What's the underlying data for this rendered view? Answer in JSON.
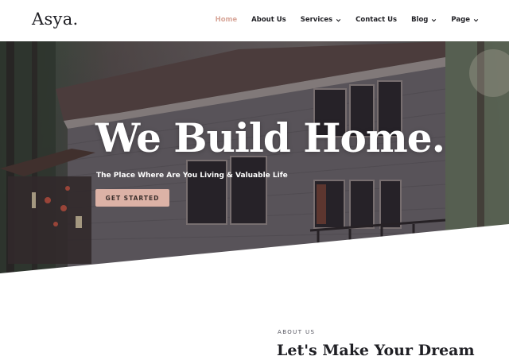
{
  "brand": {
    "logo_text": "Asya."
  },
  "nav": {
    "items": [
      {
        "label": "Home",
        "active": true,
        "has_dropdown": false
      },
      {
        "label": "About Us",
        "active": false,
        "has_dropdown": false
      },
      {
        "label": "Services",
        "active": false,
        "has_dropdown": true
      },
      {
        "label": "Contact Us",
        "active": false,
        "has_dropdown": false
      },
      {
        "label": "Blog",
        "active": false,
        "has_dropdown": true
      },
      {
        "label": "Page",
        "active": false,
        "has_dropdown": true
      }
    ]
  },
  "hero": {
    "title": "We Build Home.",
    "subtitle": "The Place Where Are You Living & Valuable Life",
    "cta_label": "GET STARTED"
  },
  "about": {
    "eyebrow": "ABOUT US",
    "heading": "Let's Make Your Dream"
  },
  "colors": {
    "accent": "#dcb2a6",
    "nav_active": "#d8a79a",
    "text_dark": "#1f1f24"
  }
}
